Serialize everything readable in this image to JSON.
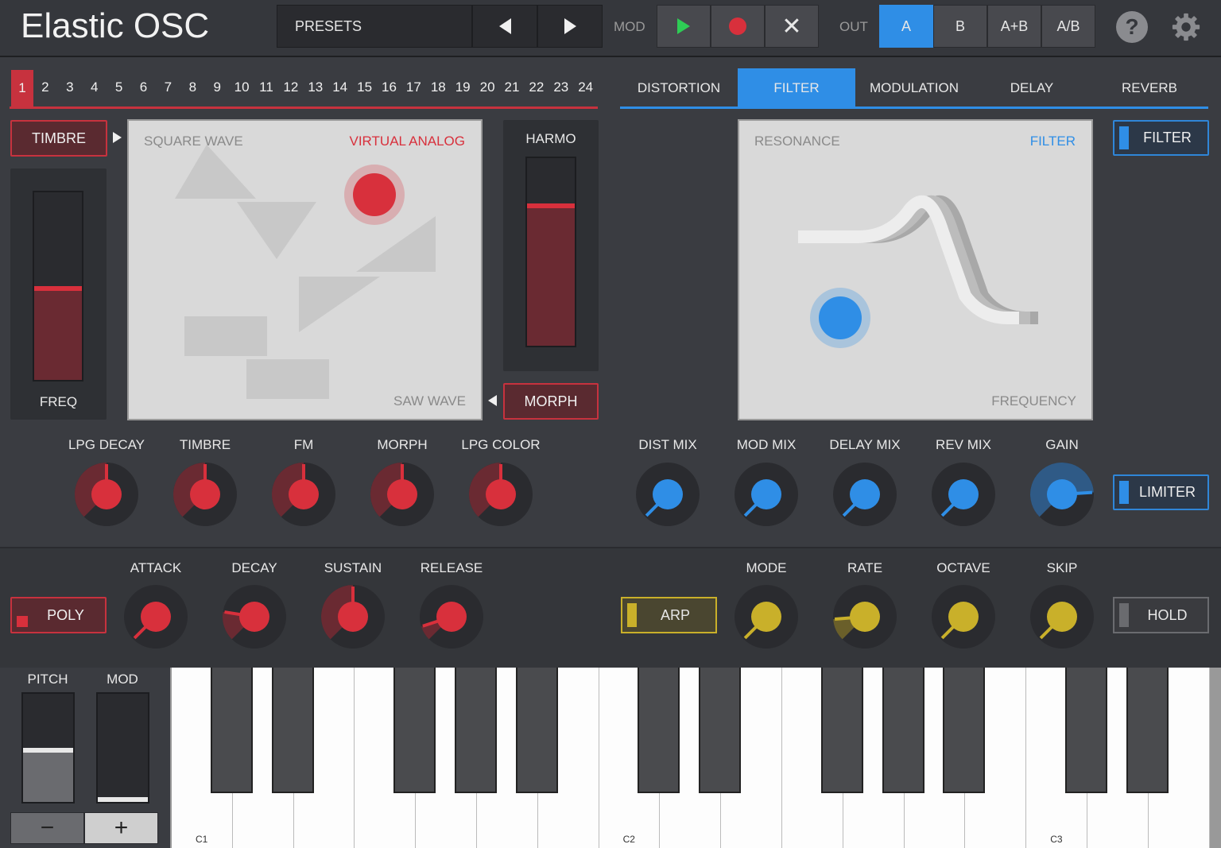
{
  "header": {
    "title": "Elastic OSC",
    "presets_label": "PRESETS",
    "mod_label": "MOD",
    "out_label": "OUT",
    "out_options": [
      "A",
      "B",
      "A+B",
      "A/B"
    ],
    "out_selected": "A"
  },
  "channels": [
    "1",
    "2",
    "3",
    "4",
    "5",
    "6",
    "7",
    "8",
    "9",
    "10",
    "11",
    "12",
    "13",
    "14",
    "15",
    "16",
    "17",
    "18",
    "19",
    "20",
    "21",
    "22",
    "23",
    "24"
  ],
  "channel_selected": "1",
  "oscillator": {
    "timbre_button": "TIMBRE",
    "freq_label": "FREQ",
    "harmo_label": "HARMO",
    "morph_button": "MORPH",
    "pad_top_left": "SQUARE WAVE",
    "pad_top_right": "VIRTUAL ANALOG",
    "pad_bottom_right": "SAW WAVE",
    "freq_level": 0.5,
    "harmo_level": 0.76
  },
  "tabs": [
    "DISTORTION",
    "FILTER",
    "MODULATION",
    "DELAY",
    "REVERB"
  ],
  "tab_selected": "FILTER",
  "filter": {
    "pad_top_left": "RESONANCE",
    "pad_top_right": "FILTER",
    "pad_bottom_right": "FREQUENCY",
    "toggle_label": "FILTER",
    "limiter_label": "LIMITER"
  },
  "osc_knobs": [
    "LPG DECAY",
    "TIMBRE",
    "FM",
    "MORPH",
    "LPG COLOR"
  ],
  "fx_knobs": [
    "DIST MIX",
    "MOD MIX",
    "DELAY MIX",
    "REV MIX",
    "GAIN"
  ],
  "env_knobs": [
    "ATTACK",
    "DECAY",
    "SUSTAIN",
    "RELEASE"
  ],
  "arp_knobs": [
    "MODE",
    "RATE",
    "OCTAVE",
    "SKIP"
  ],
  "buttons": {
    "poly": "POLY",
    "arp": "ARP",
    "hold": "HOLD"
  },
  "wheels": {
    "pitch_label": "PITCH",
    "mod_label": "MOD",
    "minus": "−",
    "plus": "+",
    "pitch_level": 0.5,
    "mod_level": 0.0
  },
  "keyboard": {
    "notes": [
      "C1",
      "C2",
      "C3"
    ]
  },
  "colors": {
    "accent_red": "#d8303c",
    "accent_blue": "#2f8ee6",
    "accent_yellow": "#c9b02a",
    "play_green": "#2ecc55"
  }
}
